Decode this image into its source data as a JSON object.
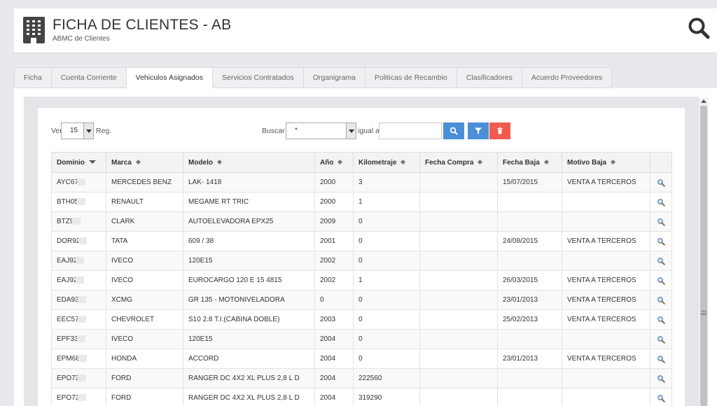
{
  "header": {
    "title": "FICHA DE CLIENTES - AB",
    "subtitle": "ABMC de Clientes"
  },
  "tabs": [
    {
      "label": "Ficha",
      "active": false
    },
    {
      "label": "Cuenta Corriente",
      "active": false
    },
    {
      "label": "Vehiculos Asignados",
      "active": true
    },
    {
      "label": "Servicios Contratados",
      "active": false
    },
    {
      "label": "Organigrama",
      "active": false
    },
    {
      "label": "Politicas de Recambio",
      "active": false
    },
    {
      "label": "Clasificadores",
      "active": false
    },
    {
      "label": "Acuerdo Proveedores",
      "active": false
    }
  ],
  "toolbar": {
    "ver_label": "Ver",
    "per_page": "15",
    "reg_label": "Reg.",
    "buscar_label": "Buscar",
    "field_value": "*",
    "operator_label": "igual a",
    "search_value": ""
  },
  "colors": {
    "primary": "#4a8fd8",
    "danger": "#f05b4f"
  },
  "table": {
    "columns": [
      "Dominio",
      "Marca",
      "Modelo",
      "Año",
      "Kilometraje",
      "Fecha Compra",
      "Fecha Baja",
      "Motivo Baja"
    ],
    "rows": [
      [
        "AYC67",
        "MERCEDES BENZ",
        "LAK- 1418",
        "2000",
        "3",
        "",
        "15/07/2015",
        "VENTA A TERCEROS"
      ],
      [
        "BTH05",
        "RENAULT",
        "MEGAME RT TRIC",
        "2000",
        "1",
        "",
        "",
        ""
      ],
      [
        "BTZ9",
        "CLARK",
        "AUTOELEVADORA EPX25",
        "2009",
        "0",
        "",
        "",
        ""
      ],
      [
        "DOR92",
        "TATA",
        "609 / 38",
        "2001",
        "0",
        "",
        "24/08/2015",
        "VENTA A TERCEROS"
      ],
      [
        "EAJ92",
        "IVECO",
        "120E15",
        "2002",
        "0",
        "",
        "",
        ""
      ],
      [
        "EAJ92",
        "IVECO",
        "EUROCARGO 120 E 15 4815",
        "2002",
        "1",
        "",
        "26/03/2015",
        "VENTA A TERCEROS"
      ],
      [
        "EDA93",
        "XCMG",
        "GR 135 - MOTONIVELADORA",
        "0",
        "0",
        "",
        "23/01/2013",
        "VENTA A TERCEROS"
      ],
      [
        "EEC57",
        "CHEVROLET",
        "S10 2.8 T.I.(CABINA DOBLE)",
        "2003",
        "0",
        "",
        "25/02/2013",
        "VENTA A TERCEROS"
      ],
      [
        "EPF33",
        "IVECO",
        "120E15",
        "2004",
        "0",
        "",
        "",
        ""
      ],
      [
        "EPM68",
        "HONDA",
        "ACCORD",
        "2004",
        "0",
        "",
        "23/01/2013",
        "VENTA A TERCEROS"
      ],
      [
        "EPO73",
        "FORD",
        "RANGER DC 4X2 XL PLUS 2,8 L D",
        "2004",
        "222560",
        "",
        "",
        ""
      ],
      [
        "EPO73",
        "FORD",
        "RANGER DC 4X2 XL PLUS 2,8 L D",
        "2004",
        "319290",
        "",
        "",
        ""
      ]
    ]
  }
}
